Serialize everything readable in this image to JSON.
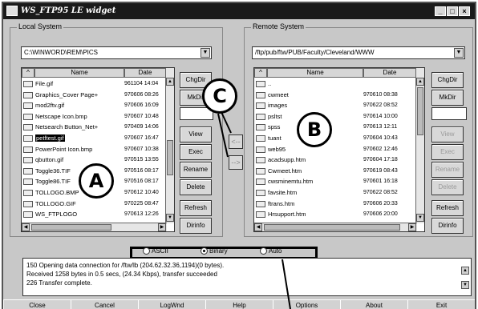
{
  "window": {
    "title": "WS_FTP95 LE widget"
  },
  "local": {
    "group_label": "Local System",
    "path": "C:\\WINWORD\\REM\\PICS",
    "headers": {
      "name": "Name",
      "date": "Date"
    },
    "files": [
      {
        "name": "File.gif",
        "date": "961104 14:04"
      },
      {
        "name": "Graphics_Cover Page+",
        "date": "970606 08:26"
      },
      {
        "name": "mod2ftv.gif",
        "date": "970606 16:09"
      },
      {
        "name": "Netscape Icon.bmp",
        "date": "970607 10:48"
      },
      {
        "name": "Netsearch Button_Net+",
        "date": "970409 14:06"
      },
      {
        "name": "petftest.gif",
        "date": "970607 16:47"
      },
      {
        "name": "PowerPoint Icon.bmp",
        "date": "970607 10:38"
      },
      {
        "name": "qbutton.gif",
        "date": "970515 13:55"
      },
      {
        "name": "Toggle36.TIF",
        "date": "970516 08:17"
      },
      {
        "name": "Toggle86.TIF",
        "date": "970516 08:17"
      },
      {
        "name": "TOLLOGO.BMP",
        "date": "970612 10:40"
      },
      {
        "name": "TOLLOGO.GIF",
        "date": "970225 08:47"
      },
      {
        "name": "WS_FTPLOGO",
        "date": "970613 12:26"
      }
    ],
    "buttons": [
      "ChgDir",
      "MkDir",
      "View",
      "Exec",
      "Rename",
      "Delete",
      "Refresh",
      "Dirinfo"
    ]
  },
  "remote": {
    "group_label": "Remote System",
    "path": "/ftp/pub/ftw/PUB/Faculty/Cleveland/WWW",
    "headers": {
      "name": "Name",
      "date": "Date"
    },
    "files": [
      {
        "name": "..",
        "date": ""
      },
      {
        "name": "cwmeet",
        "date": "970610 08:38"
      },
      {
        "name": "images",
        "date": "970622 08:52"
      },
      {
        "name": "psltst",
        "date": "970614 10:00"
      },
      {
        "name": "spss",
        "date": "970613 12:11"
      },
      {
        "name": "tuant",
        "date": "970604 10:43"
      },
      {
        "name": "web95",
        "date": "970602 12:46"
      },
      {
        "name": "acadsupp.htm",
        "date": "970604 17:18"
      },
      {
        "name": "Cwmeet.htm",
        "date": "970619 08:43"
      },
      {
        "name": "cwsminemtu.htm",
        "date": "970601 16:18"
      },
      {
        "name": "favsite.htm",
        "date": "970622 08:52"
      },
      {
        "name": "ftrans.htm",
        "date": "970606 20:33"
      },
      {
        "name": "Hrsupport.htm",
        "date": "970606 20:00"
      }
    ],
    "buttons": [
      "ChgDir",
      "MkDir",
      "View",
      "Exec",
      "Rename",
      "Delete",
      "Refresh",
      "Dirinfo"
    ]
  },
  "transfer": {
    "to_local": "<--",
    "to_remote": "-->"
  },
  "modes": [
    {
      "label": "ASCII",
      "selected": false
    },
    {
      "label": "Binary",
      "selected": true
    },
    {
      "label": "Auto",
      "selected": false
    }
  ],
  "log": [
    "150 Opening data connection for /ftw/lb (204.62.32.36,1194)(0 bytes).",
    "Received 1258 bytes in 0.5 secs, (24.34 Kbps), transfer succeeded",
    "226 Transfer complete."
  ],
  "bottom_buttons": [
    "Close",
    "Cancel",
    "LogWnd",
    "Help",
    "Options",
    "About",
    "Exit"
  ],
  "callouts": {
    "a": "A",
    "b": "B",
    "c": "C"
  }
}
